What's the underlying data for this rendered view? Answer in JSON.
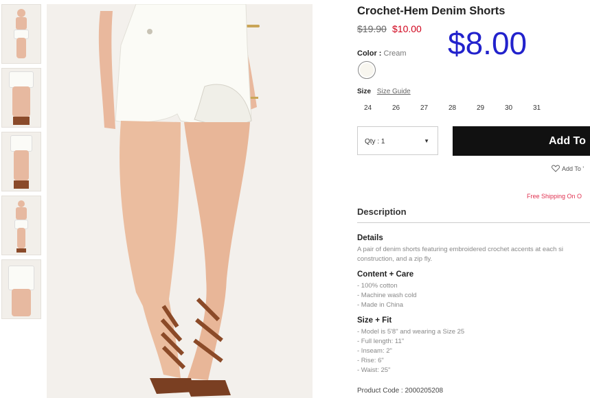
{
  "product": {
    "title": "Crochet-Hem Denim Shorts",
    "price_original": "$19.90",
    "price_sale": "$10.00",
    "price_overlay": "$8.00",
    "color_label": "Color :",
    "color_value": "Cream",
    "size_label": "Size",
    "size_guide": "Size Guide",
    "sizes": [
      "24",
      "26",
      "27",
      "28",
      "29",
      "30",
      "31"
    ],
    "qty_label": "Qty : 1",
    "add_button": "Add To",
    "wishlist": "Add To '",
    "shipping": "Free Shipping On O",
    "description_heading": "Description",
    "details_heading": "Details",
    "details_line1": "A pair of denim shorts featuring embroidered crochet accents at each si",
    "details_line2": "construction, and a zip fly.",
    "care_heading": "Content + Care",
    "care_items": [
      "- 100% cotton",
      "- Machine wash cold",
      "- Made in China"
    ],
    "fit_heading": "Size + Fit",
    "fit_items": [
      "- Model is 5'8\" and wearing a Size 25",
      "- Full length: 11\"",
      "- Inseam: 2\"",
      "- Rise: 6\"",
      "- Waist: 25\""
    ],
    "product_code": "Product Code : 2000205208"
  },
  "colors": {
    "sale_price": "#d0021b",
    "overlay_price": "#2222cc",
    "button_bg": "#111111",
    "shipping_text": "#e0304f"
  },
  "icons": {
    "wishlist": "heart-outline-icon",
    "qty_dropdown": "caret-down-icon"
  }
}
